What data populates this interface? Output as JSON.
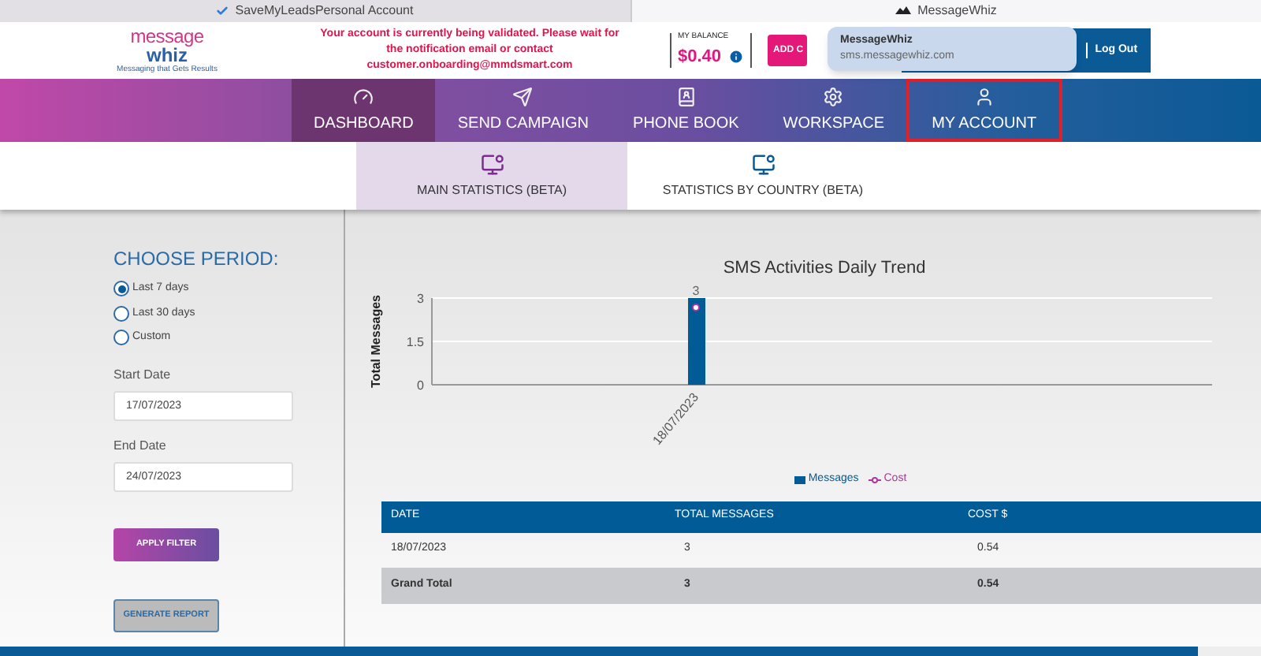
{
  "browser_tabs": [
    {
      "label": "SaveMyLeadsPersonal Account",
      "selected": false
    },
    {
      "label": "MessageWhiz",
      "selected": true
    }
  ],
  "header": {
    "logo_top": "message",
    "logo_bottom": "whiz",
    "tagline": "Messaging that Gets Results",
    "alert": "Your account is currently being validated. Please wait for the notification email or contact customer.onboarding@mmdsmart.com",
    "balance_label": "MY BALANCE",
    "balance": "$0.40",
    "add_credit": "ADD C",
    "logout": "Log Out"
  },
  "notification": {
    "title": "MessageWhiz",
    "url": "sms.messagewhiz.com"
  },
  "nav": [
    {
      "label": "DASHBOARD",
      "selected": true,
      "highlighted": false
    },
    {
      "label": "SEND CAMPAIGN",
      "selected": false,
      "highlighted": false
    },
    {
      "label": "PHONE BOOK",
      "selected": false,
      "highlighted": false
    },
    {
      "label": "WORKSPACE",
      "selected": false,
      "highlighted": false
    },
    {
      "label": "MY ACCOUNT",
      "selected": false,
      "highlighted": true
    }
  ],
  "subtabs": [
    {
      "label": "MAIN STATISTICS (BETA)",
      "selected": true
    },
    {
      "label": "STATISTICS BY COUNTRY (BETA)",
      "selected": false
    }
  ],
  "filter": {
    "title": "CHOOSE PERIOD:",
    "options": [
      {
        "label": "Last 7 days",
        "selected": true
      },
      {
        "label": "Last 30 days",
        "selected": false
      },
      {
        "label": "Custom",
        "selected": false
      }
    ],
    "start_label": "Start Date",
    "start_value": "17/07/2023",
    "end_label": "End Date",
    "end_value": "24/07/2023",
    "apply": "APPLY FILTER",
    "report": "GENERATE REPORT"
  },
  "chart": {
    "chart_data": {
      "type": "bar",
      "title": "SMS Activities Daily Trend",
      "ylabel": "Total Messages",
      "categories": [
        "18/07/2023"
      ],
      "series": [
        {
          "name": "Messages",
          "color": "#005b96",
          "values": [
            3
          ]
        }
      ],
      "ylim": [
        0,
        3
      ],
      "yticks": [
        0,
        1.5,
        3
      ],
      "value_labels": [
        "3"
      ]
    },
    "cost_legend": {
      "name": "Cost"
    }
  },
  "table": {
    "columns": [
      "DATE",
      "TOTAL MESSAGES",
      "COST $"
    ],
    "rows": [
      [
        "18/07/2023",
        "3",
        "0.54"
      ]
    ],
    "total": [
      "Grand Total",
      "3",
      "0.54"
    ]
  }
}
